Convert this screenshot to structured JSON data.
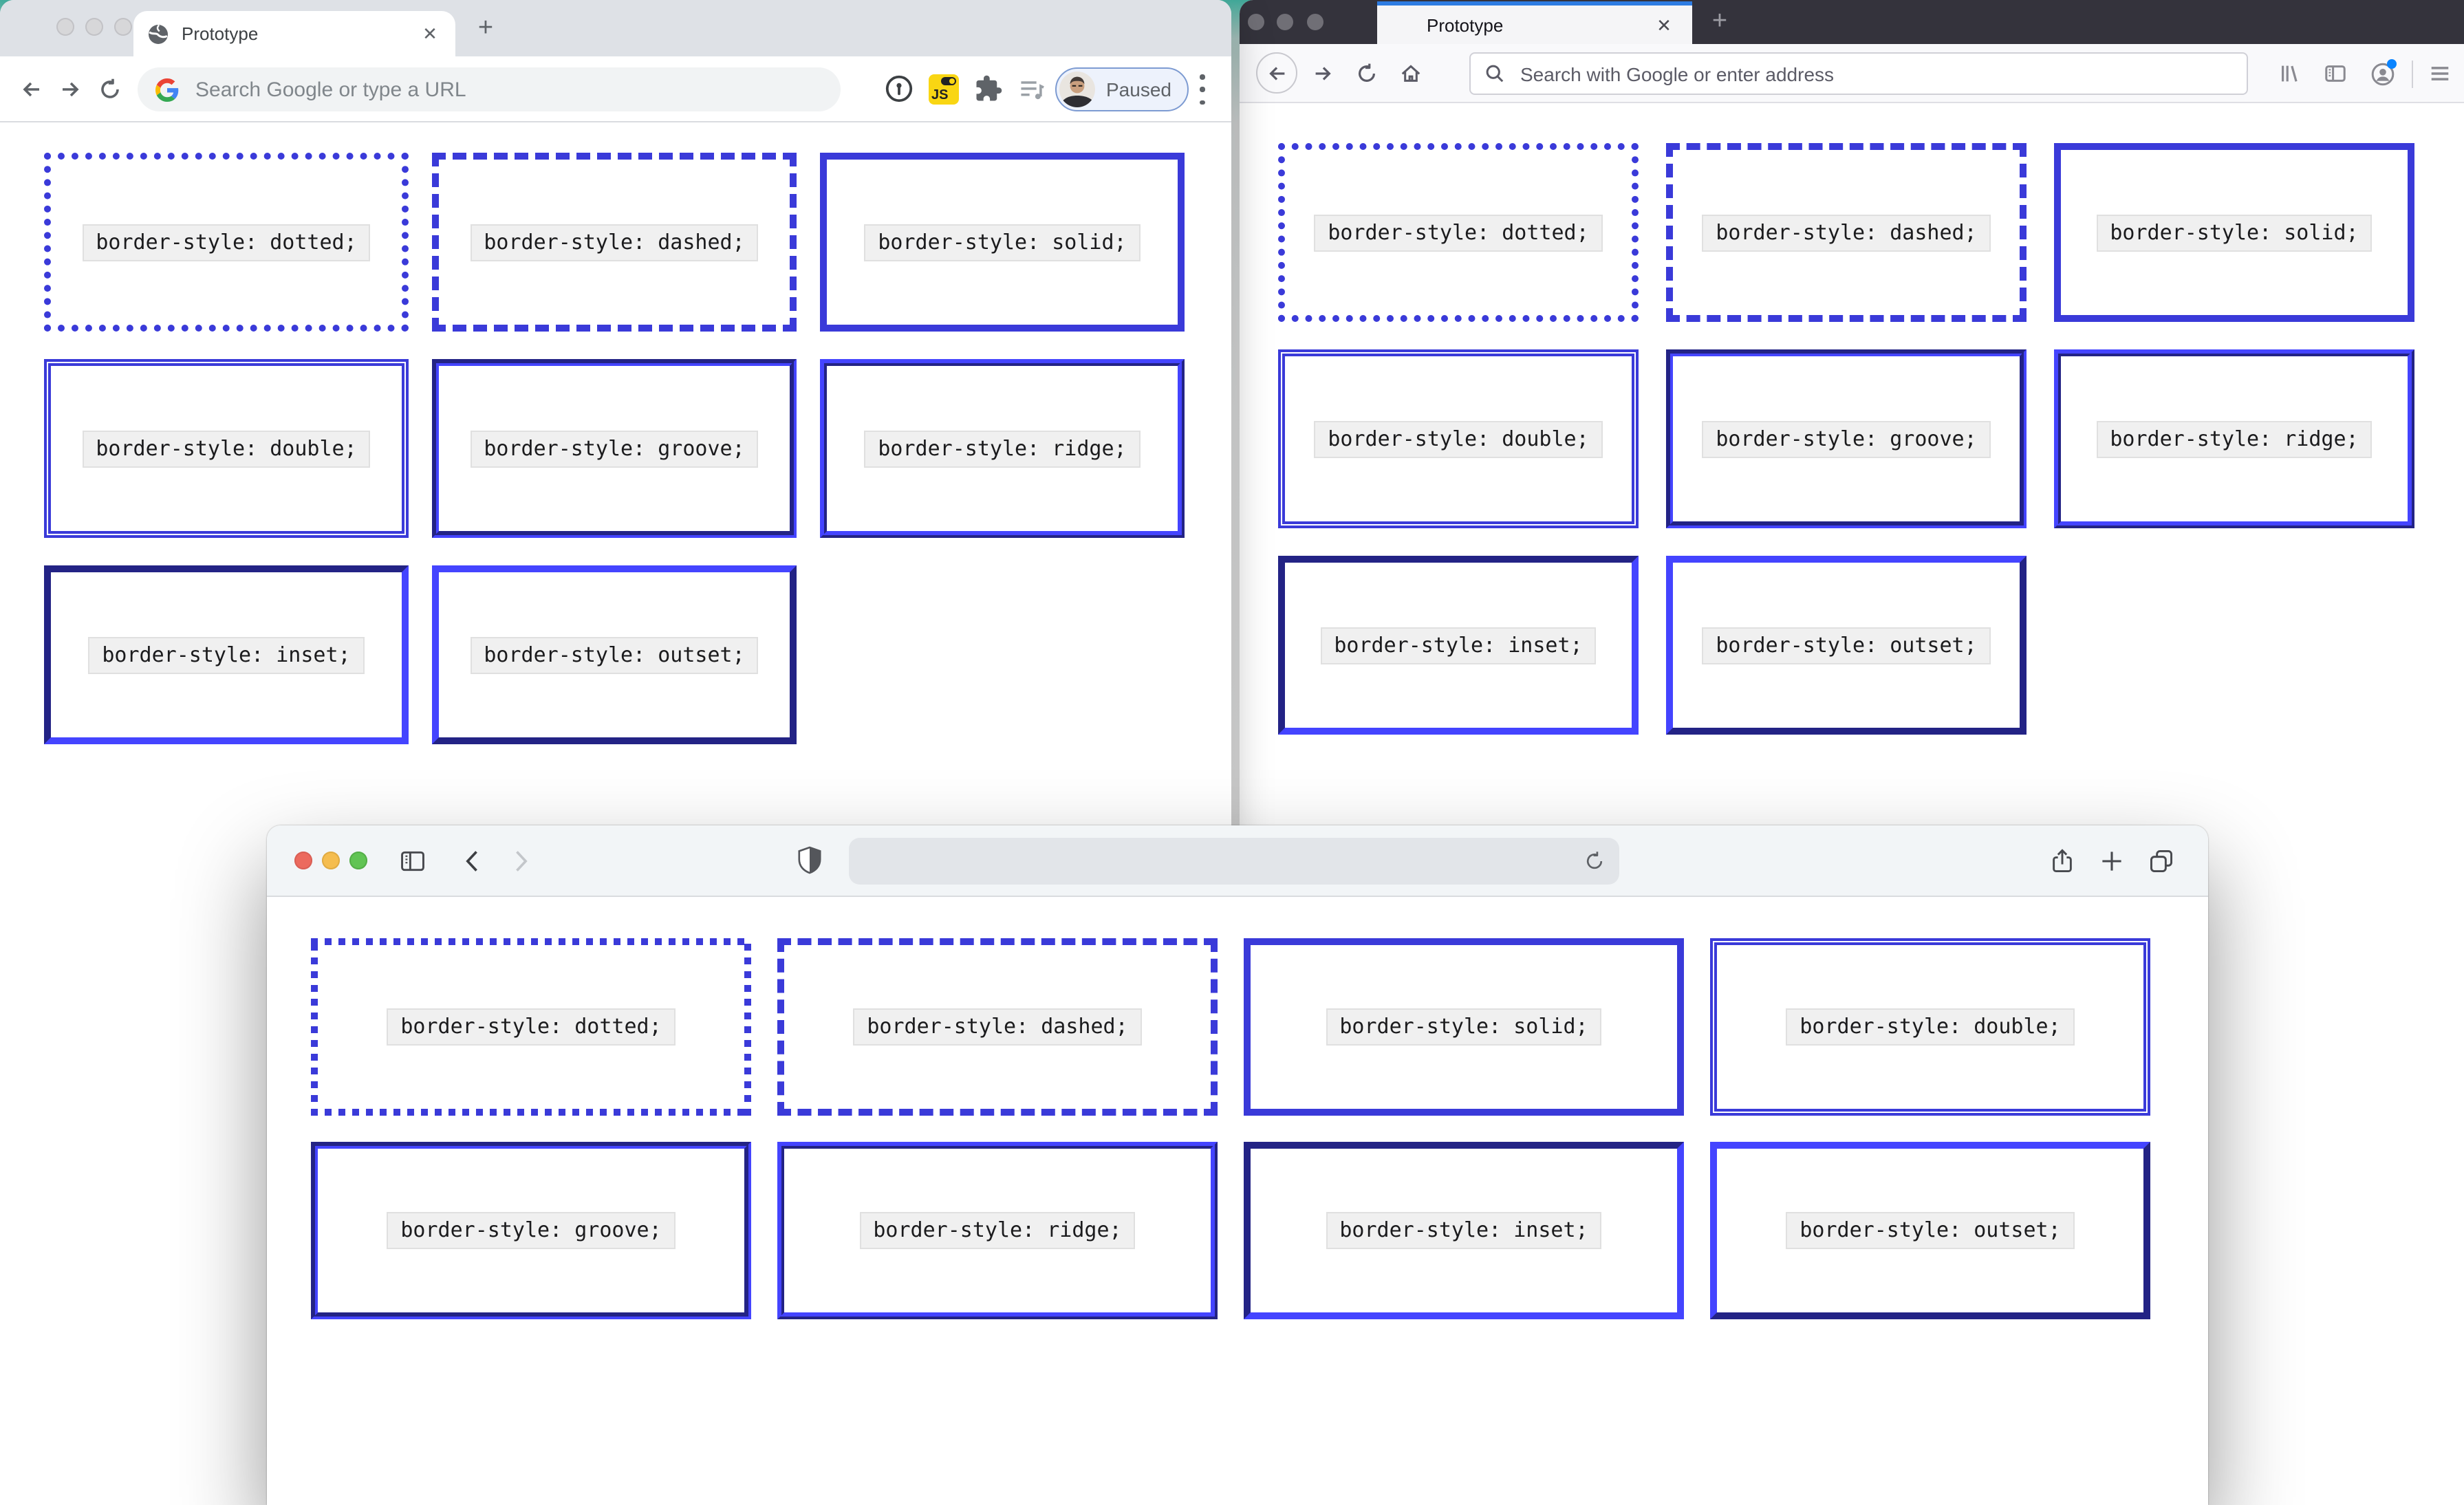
{
  "colors": {
    "accent_blue": "#3a3ad9",
    "wallpaper_teal": "#45b3a2",
    "firefox_tab_accent": "#2d7ce2",
    "chrome_js_badge_yellow": "#f9d613",
    "traffic_red": "#ec6a5e",
    "traffic_yellow": "#f5bd4f",
    "traffic_green": "#61c454"
  },
  "chrome": {
    "tab_title": "Prototype",
    "close_tab_glyph": "✕",
    "new_tab_glyph": "+",
    "address_placeholder": "Search Google or type a URL",
    "js_badge_label": "JS",
    "profile_chip_label": "Paused",
    "boxes": [
      {
        "style": "dotted",
        "label": "border-style: dotted;"
      },
      {
        "style": "dashed",
        "label": "border-style: dashed;"
      },
      {
        "style": "solid",
        "label": "border-style: solid;"
      },
      {
        "style": "double",
        "label": "border-style: double;"
      },
      {
        "style": "groove",
        "label": "border-style: groove;"
      },
      {
        "style": "ridge",
        "label": "border-style: ridge;"
      },
      {
        "style": "inset",
        "label": "border-style: inset;"
      },
      {
        "style": "outset",
        "label": "border-style: outset;"
      }
    ]
  },
  "firefox": {
    "tab_title": "Prototype",
    "close_tab_glyph": "✕",
    "new_tab_glyph": "+",
    "address_placeholder": "Search with Google or enter address",
    "boxes": [
      {
        "style": "dotted",
        "label": "border-style: dotted;"
      },
      {
        "style": "dashed",
        "label": "border-style: dashed;"
      },
      {
        "style": "solid",
        "label": "border-style: solid;"
      },
      {
        "style": "double",
        "label": "border-style: double;"
      },
      {
        "style": "groove",
        "label": "border-style: groove;"
      },
      {
        "style": "ridge",
        "label": "border-style: ridge;"
      },
      {
        "style": "inset",
        "label": "border-style: inset;"
      },
      {
        "style": "outset",
        "label": "border-style: outset;"
      }
    ]
  },
  "safari": {
    "address_value": "",
    "boxes": [
      {
        "style": "dotted",
        "label": "border-style: dotted;"
      },
      {
        "style": "dashed",
        "label": "border-style: dashed;"
      },
      {
        "style": "solid",
        "label": "border-style: solid;"
      },
      {
        "style": "double",
        "label": "border-style: double;"
      },
      {
        "style": "groove",
        "label": "border-style: groove;"
      },
      {
        "style": "ridge",
        "label": "border-style: ridge;"
      },
      {
        "style": "inset",
        "label": "border-style: inset;"
      },
      {
        "style": "outset",
        "label": "border-style: outset;"
      }
    ]
  }
}
